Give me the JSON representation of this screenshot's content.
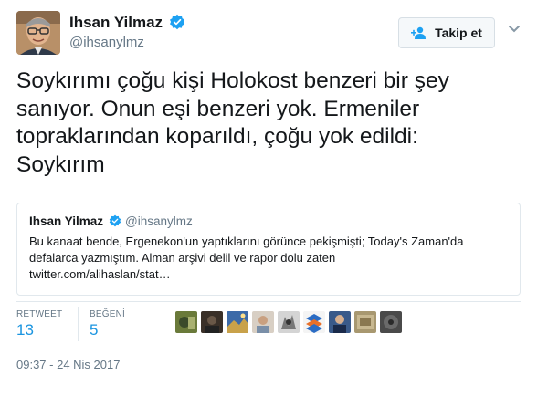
{
  "author": {
    "name": "Ihsan Yilmaz",
    "handle": "@ihsanylmz"
  },
  "follow_button": {
    "label": "Takip et",
    "icon": "add-user-icon"
  },
  "tweet": {
    "lines": [
      "Soykırımı çoğu kişi Holokost benzeri bir şey",
      "sanıyor. Onun eşi benzeri yok. Ermeniler",
      "topraklarından koparıldı, çoğu yok edildi:",
      "Soykırım"
    ]
  },
  "quote": {
    "name": "Ihsan Yilmaz",
    "handle": "@ihsanylmz",
    "lines": [
      "Bu kanaat bende, Ergenekon'un yaptıklarını görünce pekişmişti; Today's Zaman'da",
      "defalarca yazmıştım. Alman arşivi delil ve rapor dolu zaten",
      "twitter.com/alihaslan/stat…"
    ]
  },
  "stats": {
    "retweet_label": "RETWEET",
    "retweet_count": "13",
    "like_label": "BEĞENİ",
    "like_count": "5"
  },
  "timestamp": "09:37 - 24 Nis 2017",
  "colors": {
    "link_blue": "#1b95e0",
    "verified_blue": "#1da1f2",
    "secondary_text": "#657786",
    "border": "#e1e8ed"
  }
}
